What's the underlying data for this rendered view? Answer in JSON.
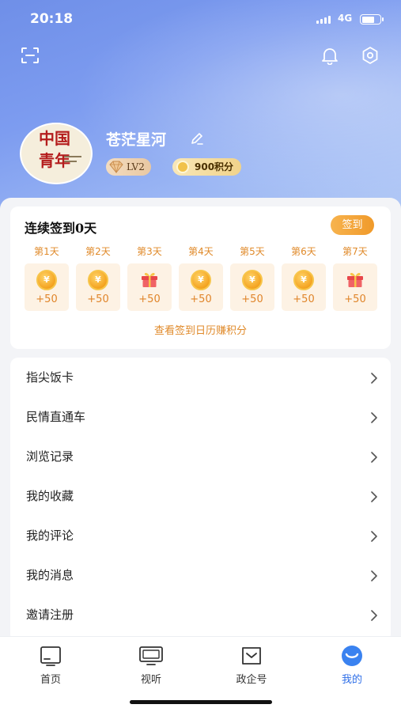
{
  "status": {
    "time": "20:18",
    "network": "4G"
  },
  "profile": {
    "avatar_text_1": "中国",
    "avatar_text_2": "青年",
    "username": "苍茫星河",
    "level": "LV2",
    "points": "900积分"
  },
  "signin": {
    "title": "连续签到0天",
    "button_label": "签到",
    "calendar_link": "查看签到日历赚积分",
    "days": [
      {
        "label": "第1天",
        "reward": "+50",
        "icon": "coin-icon"
      },
      {
        "label": "第2天",
        "reward": "+50",
        "icon": "coin-icon"
      },
      {
        "label": "第3天",
        "reward": "+50",
        "icon": "gift-icon"
      },
      {
        "label": "第4天",
        "reward": "+50",
        "icon": "coin-icon"
      },
      {
        "label": "第5天",
        "reward": "+50",
        "icon": "coin-icon"
      },
      {
        "label": "第6天",
        "reward": "+50",
        "icon": "coin-icon"
      },
      {
        "label": "第7天",
        "reward": "+50",
        "icon": "gift-icon"
      }
    ],
    "coin_glyph": "¥"
  },
  "menu": {
    "items": [
      {
        "label": "指尖饭卡"
      },
      {
        "label": "民情直通车"
      },
      {
        "label": "浏览记录"
      },
      {
        "label": "我的收藏"
      },
      {
        "label": "我的评论"
      },
      {
        "label": "我的消息"
      },
      {
        "label": "邀请注册"
      }
    ]
  },
  "tabbar": {
    "items": [
      {
        "label": "首页",
        "icon": "home-tv-icon",
        "active": false
      },
      {
        "label": "视听",
        "icon": "monitor-icon",
        "active": false
      },
      {
        "label": "政企号",
        "icon": "bookmark-icon",
        "active": false
      },
      {
        "label": "我的",
        "icon": "profile-smile-icon",
        "active": true
      }
    ]
  },
  "colors": {
    "accent_orange": "#f09a2a",
    "accent_blue": "#2f6fe8",
    "hero_gradient_start": "#6f8fe8"
  }
}
